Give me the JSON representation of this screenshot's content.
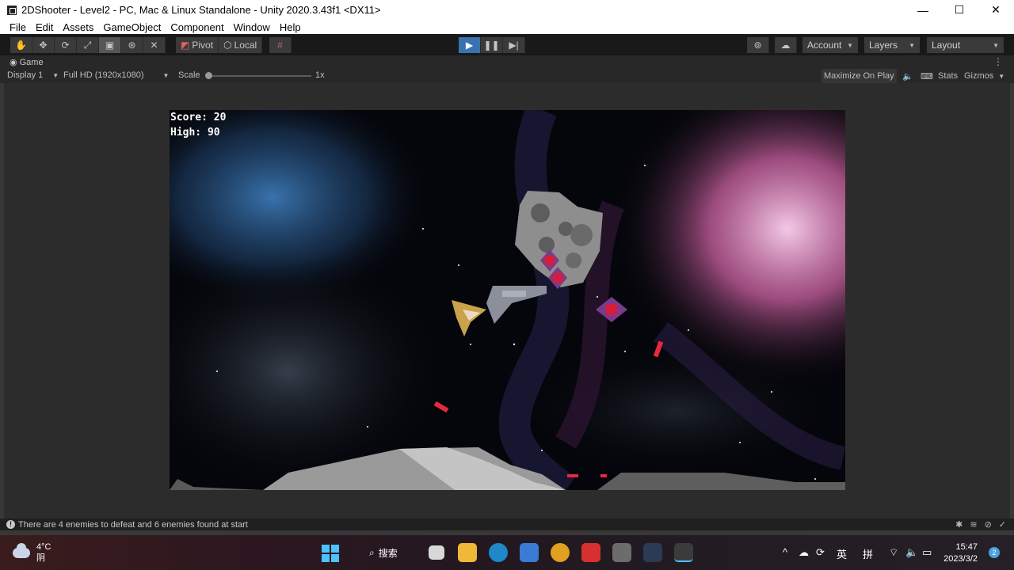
{
  "window": {
    "title": "2DShooter - Level2 - PC, Mac & Linux Standalone - Unity 2020.3.43f1 <DX11>",
    "minimize": "—",
    "maximize": "☐",
    "close": "✕"
  },
  "menu": [
    "File",
    "Edit",
    "Assets",
    "GameObject",
    "Component",
    "Window",
    "Help"
  ],
  "toolbar": {
    "pivot_label": "Pivot",
    "local_label": "Local",
    "account_label": "Account",
    "layers_label": "Layers",
    "layout_label": "Layout"
  },
  "game_view": {
    "tab_label": "Game",
    "display": "Display 1",
    "resolution": "Full HD (1920x1080)",
    "scale_label": "Scale",
    "scale_value": "1x",
    "maximize_on_play": "Maximize On Play",
    "stats": "Stats",
    "gizmos": "Gizmos"
  },
  "hud": {
    "score": "Score: 20",
    "high": "High: 90"
  },
  "status": {
    "message": "There are 4 enemies to defeat and 6 enemies found at start"
  },
  "taskbar": {
    "temperature": "4°C",
    "weather": "阴",
    "search_label": "搜索",
    "ime_lang": "英",
    "ime_mode": "拼",
    "time": "15:47",
    "date": "2023/3/2",
    "notifications": "2"
  },
  "colors": {
    "play_accent": "#3a72b0",
    "editor_bg": "#282828",
    "toolbar_bg": "#191919"
  }
}
